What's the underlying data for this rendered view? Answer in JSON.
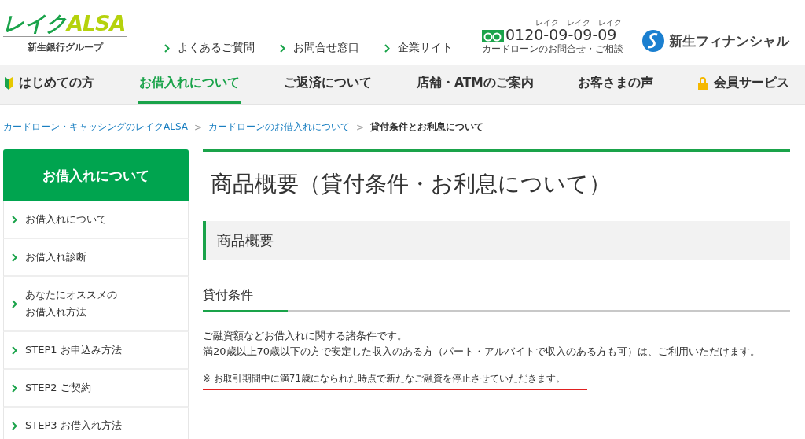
{
  "logo": {
    "kana": "レイク",
    "latin": "ALSA",
    "tagline": "新生銀行グループ"
  },
  "header_links": [
    {
      "label": "よくあるご質問"
    },
    {
      "label": "お問合せ窓口"
    },
    {
      "label": "企業サイト"
    }
  ],
  "phone": {
    "number": "0120-09-09-09",
    "readings": [
      "レイク",
      "レイク",
      "レイク"
    ],
    "caption": "カードローンのお問合せ・ご相談"
  },
  "group_logo": {
    "text": "新生フィナンシャル"
  },
  "nav": [
    {
      "label": "はじめての方",
      "kind": "beginner",
      "selected": false
    },
    {
      "label": "お借入れについて",
      "selected": true
    },
    {
      "label": "ご返済について",
      "selected": false
    },
    {
      "label": "店舗・ATMのご案内",
      "selected": false
    },
    {
      "label": "お客さまの声",
      "selected": false
    },
    {
      "label": "会員サービス",
      "kind": "lock",
      "selected": false
    }
  ],
  "breadcrumb": [
    {
      "label": "カードローン・キャッシングのレイクALSA",
      "current": false
    },
    {
      "separator": ">",
      "label": "カードローンのお借入れについて",
      "current": false
    },
    {
      "separator": ">",
      "label": "貸付条件とお利息について",
      "current": true
    }
  ],
  "sidebar": {
    "title": "お借入れについて",
    "items": [
      {
        "label": "お借入れについて"
      },
      {
        "label": "お借入れ診断"
      },
      {
        "lines": [
          "あなたにオススメの",
          "お借入れ方法"
        ]
      },
      {
        "label": "STEP1 お申込み方法"
      },
      {
        "label": "STEP2 ご契約"
      },
      {
        "label": "STEP3 お借入れ方法"
      }
    ]
  },
  "content": {
    "title": "商品概要（貸付条件・お利息について）",
    "section": "商品概要",
    "subsection": "貸付条件",
    "paragraphs": [
      "ご融資額などお借入れに関する諸条件です。",
      "満20歳以上70歳以下の方で安定した収入のある方（パート・アルバイトで収入のある方も可）は、ご利用いただけます。"
    ],
    "note": "※ お取引期間中に満71歳になられた時点で新たなご融資を停止させていただきます。"
  }
}
